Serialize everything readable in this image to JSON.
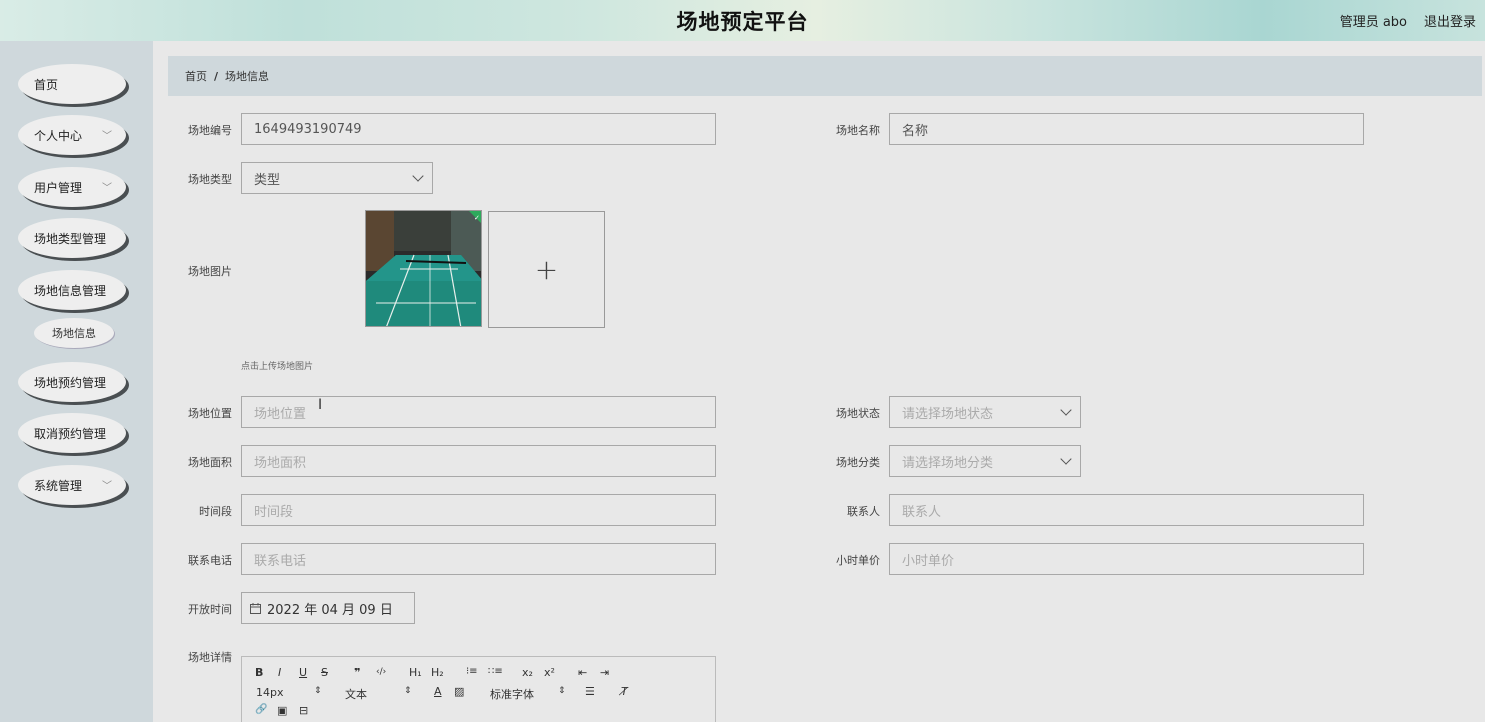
{
  "header": {
    "title": "场地预定平台",
    "user": "管理员 abo",
    "logout": "退出登录"
  },
  "sidebar": {
    "items": [
      {
        "label": "首页",
        "chevron": ""
      },
      {
        "label": "个人中心",
        "chevron": "﹀"
      },
      {
        "label": "用户管理",
        "chevron": "﹀"
      },
      {
        "label": "场地类型管理",
        "chevron": ""
      },
      {
        "label": "场地信息管理",
        "chevron": ""
      },
      {
        "label": "场地预约管理",
        "chevron": ""
      },
      {
        "label": "取消预约管理",
        "chevron": ""
      },
      {
        "label": "系统管理",
        "chevron": "﹀"
      }
    ],
    "sub_item": "场地信息"
  },
  "breadcrumb": {
    "home": "首页",
    "separator": "/",
    "current": "场地信息"
  },
  "form": {
    "code_label": "场地编号",
    "code_value": "1649493190749",
    "name_label": "场地名称",
    "name_placeholder": "名称",
    "type_label": "场地类型",
    "type_value": "类型",
    "image_label": "场地图片",
    "upload_hint": "点击上传场地图片",
    "upload_plus": "+",
    "location_label": "场地位置",
    "location_placeholder": "场地位置",
    "status_label": "场地状态",
    "status_placeholder": "请选择场地状态",
    "area_label": "场地面积",
    "area_placeholder": "场地面积",
    "category_label": "场地分类",
    "category_placeholder": "请选择场地分类",
    "period_label": "时间段",
    "period_placeholder": "时间段",
    "contact_label": "联系人",
    "contact_placeholder": "联系人",
    "phone_label": "联系电话",
    "phone_placeholder": "联系电话",
    "price_label": "小时单价",
    "price_placeholder": "小时单价",
    "open_label": "开放时间",
    "open_value": "2022 年 04 月 09 日",
    "detail_label": "场地详情"
  },
  "editor": {
    "bold": "B",
    "italic": "I",
    "underline": "U",
    "strike": "S",
    "quote": "❞",
    "code": "‹/›",
    "h1": "H₁",
    "h2": "H₂",
    "ol": "⁝≡",
    "ul": "∷≡",
    "sub": "x₂",
    "sup": "x²",
    "outdent": "⇤",
    "indent": "⇥",
    "size": "14px",
    "size_arrow": "⇕",
    "format": "文本",
    "format_arrow": "⇕",
    "color": "A",
    "bg": "▨",
    "font": "标准字体",
    "font_arrow": "⇕",
    "align": "☰",
    "clear": "T̸",
    "link": "🔗",
    "image": "▣",
    "video": "⊟"
  },
  "colors": {
    "sidebar_bg": "#cfd8dc",
    "page_bg": "#e8e8e8",
    "nav_shadow": "#4a4f52"
  }
}
